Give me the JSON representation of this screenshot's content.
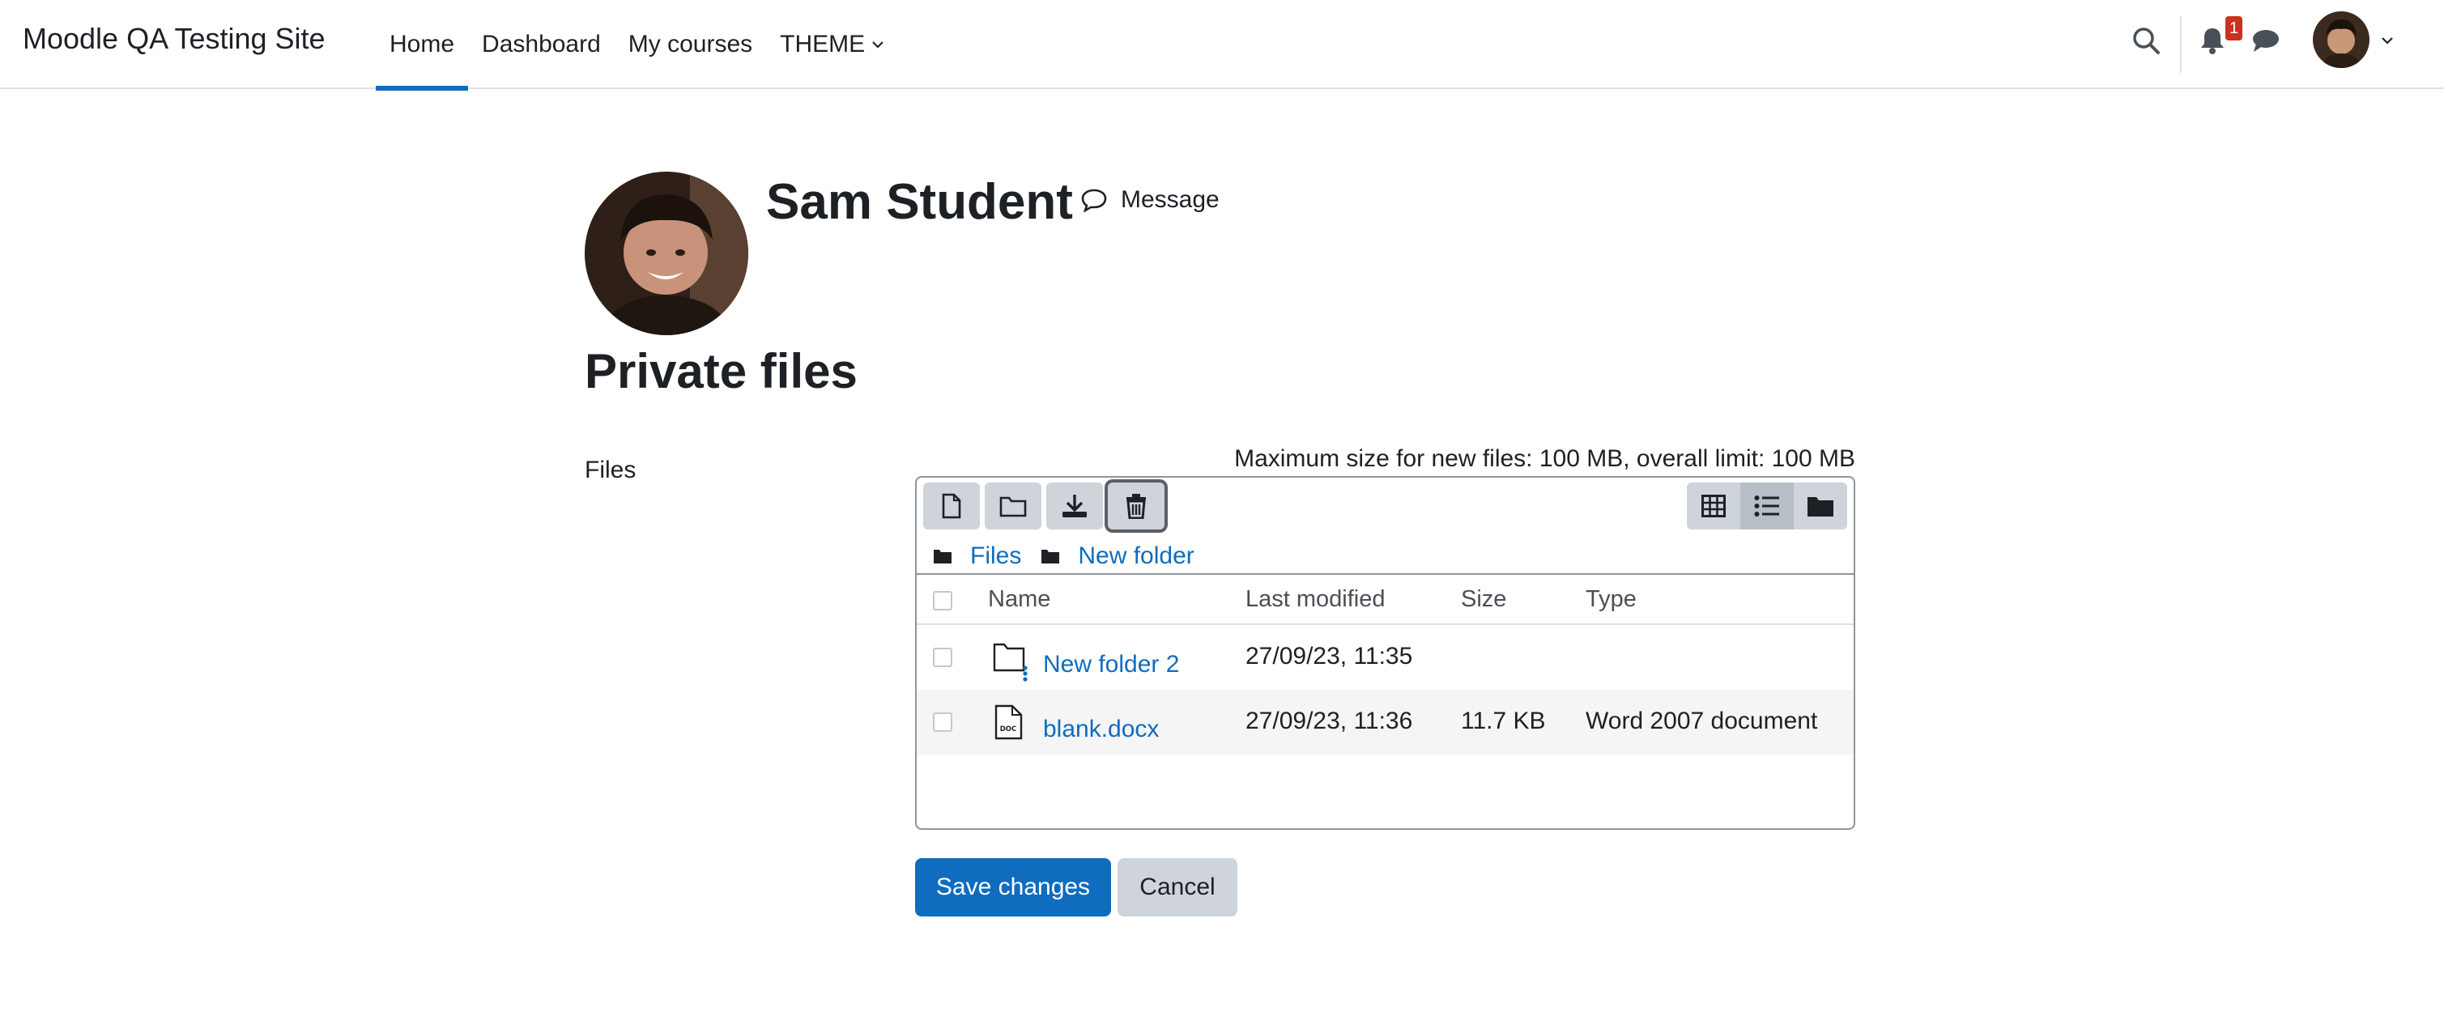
{
  "site": {
    "name": "Moodle QA Testing Site"
  },
  "nav": {
    "links": [
      {
        "label": "Home",
        "active": true
      },
      {
        "label": "Dashboard"
      },
      {
        "label": "My courses"
      },
      {
        "label": "THEME",
        "dropdown": true
      }
    ],
    "notification_count": "1",
    "icons": [
      "search-icon",
      "bell-icon",
      "chat-icon",
      "avatar",
      "chevron-down-icon"
    ]
  },
  "user": {
    "name": "Sam Student",
    "message_label": "Message"
  },
  "page": {
    "title": "Private files"
  },
  "form": {
    "files_label": "Files",
    "max_size_text": "Maximum size for new files: 100 MB, overall limit: 100 MB",
    "save_label": "Save changes",
    "cancel_label": "Cancel"
  },
  "filemanager": {
    "toolbar_icons": [
      "add-file-icon",
      "create-folder-icon",
      "download-icon",
      "delete-icon"
    ],
    "view_icons": [
      "grid-view-icon",
      "list-view-icon",
      "tree-view-icon"
    ],
    "active_view": "list",
    "path": [
      "Files",
      "New folder"
    ],
    "columns": {
      "name": "Name",
      "modified": "Last modified",
      "size": "Size",
      "type": "Type"
    },
    "rows": [
      {
        "name": "New folder 2",
        "modified": "27/09/23, 11:35",
        "size": "",
        "type": "",
        "icon": "folder-icon"
      },
      {
        "name": "blank.docx",
        "modified": "27/09/23, 11:36",
        "size": "11.7 KB",
        "type": "Word 2007 document",
        "icon": "docx-file-icon"
      }
    ]
  },
  "colors": {
    "primary": "#0f6cbf",
    "badge": "#ca3120",
    "button_secondary": "#ced4da",
    "text": "#1d2125"
  }
}
